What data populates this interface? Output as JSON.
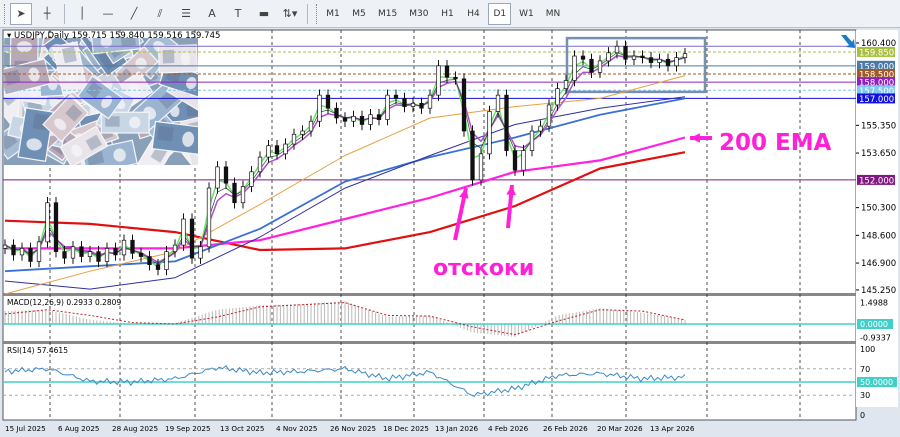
{
  "toolbar": {
    "tools": [
      {
        "name": "cursor-icon",
        "glyph": "➤"
      },
      {
        "name": "crosshair-icon",
        "glyph": "┼"
      },
      {
        "name": "vertical-line-icon",
        "glyph": "│"
      },
      {
        "name": "horizontal-line-icon",
        "glyph": "—"
      },
      {
        "name": "trendline-icon",
        "glyph": "╱"
      },
      {
        "name": "equidistant-channel-icon",
        "glyph": "⫽"
      },
      {
        "name": "fibonacci-icon",
        "glyph": "☰"
      },
      {
        "name": "text-icon",
        "glyph": "A"
      },
      {
        "name": "text-label-icon",
        "glyph": "T"
      },
      {
        "name": "rectangle-icon",
        "glyph": "▬"
      },
      {
        "name": "arrows-dropdown-icon",
        "glyph": "⇅▾"
      }
    ],
    "timeframes": [
      "M1",
      "M5",
      "M15",
      "M30",
      "H1",
      "H4",
      "D1",
      "W1",
      "MN"
    ],
    "active_timeframe": "D1"
  },
  "chart_data": {
    "type": "candlestick",
    "header": "USDJPY,Daily  159.715 159.840 159.516 159.745",
    "symbol": "USDJPY",
    "period": "Daily",
    "ohlc_last": {
      "open": 159.715,
      "high": 159.84,
      "low": 159.516,
      "close": 159.745
    },
    "ylim": [
      145.0,
      161.2
    ],
    "y_ticks": [
      "160.400",
      "155.350",
      "153.650",
      "150.300",
      "148.600",
      "146.900",
      "145.250"
    ],
    "x_ticks": [
      "15 Jul 2025",
      "6 Aug 2025",
      "28 Aug 2025",
      "19 Sep 2025",
      "13 Oct 2025",
      "4 Nov 2025",
      "26 Nov 2025",
      "18 Dec 2025",
      "13 Jan 2026",
      "4 Feb 2026",
      "26 Feb 2026",
      "20 Mar 2026",
      "13 Apr 2026"
    ],
    "date_range": [
      "15 Jul 2025",
      "22 Apr 2026"
    ],
    "closes": [
      148.0,
      147.4,
      147.8,
      147.0,
      148.2,
      150.6,
      147.6,
      147.2,
      147.9,
      147.3,
      147.6,
      147.0,
      147.8,
      147.4,
      148.3,
      147.5,
      147.3,
      146.8,
      146.5,
      147.6,
      148.0,
      149.6,
      147.2,
      147.9,
      151.5,
      152.8,
      151.8,
      150.6,
      151.6,
      152.5,
      153.4,
      154.1,
      153.6,
      154.2,
      154.8,
      155.0,
      155.6,
      157.2,
      156.4,
      155.8,
      155.6,
      155.9,
      155.4,
      156.0,
      155.7,
      157.2,
      157.0,
      156.5,
      156.7,
      156.4,
      157.2,
      159.0,
      158.3,
      158.2,
      155.0,
      152.0,
      153.6,
      156.2,
      157.2,
      153.8,
      152.6,
      153.8,
      155.0,
      155.3,
      156.6,
      157.6,
      158.1,
      159.6,
      159.4,
      158.6,
      159.3,
      159.8,
      160.2,
      159.4,
      159.6,
      159.5,
      159.2,
      159.4,
      159.0,
      159.5,
      159.745
    ],
    "moving_averages": [
      {
        "color": "#e01010",
        "values": [
          149.5,
          149.3,
          148.8,
          147.7,
          147.8,
          148.8,
          150.4,
          152.7,
          153.7
        ]
      },
      {
        "color": "#ff20e0",
        "values": [
          147.8,
          147.8,
          147.8,
          148.3,
          149.6,
          150.9,
          152.5,
          153.2,
          154.6
        ]
      },
      {
        "color": "#3a6fd8",
        "values": [
          146.4,
          146.7,
          147.0,
          149.0,
          151.9,
          153.4,
          154.6,
          156.0,
          157.0
        ]
      },
      {
        "color": "#3030a0",
        "values": [
          145.8,
          145.3,
          146.0,
          148.5,
          151.5,
          153.5,
          155.4,
          156.4,
          157.1
        ]
      },
      {
        "color": "#e8a040",
        "values": [
          145.0,
          146.4,
          147.6,
          150.5,
          153.5,
          155.8,
          156.5,
          157.0,
          158.4
        ]
      }
    ],
    "levels": [
      {
        "price": 160.2,
        "label": "",
        "color": "#7a6cc8",
        "style": "solid"
      },
      {
        "price": 159.85,
        "label": "159.850",
        "color": "#a8c040",
        "style": "dashed"
      },
      {
        "price": 159.0,
        "label": "159.000",
        "color": "#4a7aa8",
        "style": "solid"
      },
      {
        "price": 158.5,
        "label": "158.500",
        "color": "#a05a28",
        "style": "dashed"
      },
      {
        "price": 158.0,
        "label": "158.000",
        "color": "#9020c0",
        "style": "solid"
      },
      {
        "price": 157.5,
        "label": "157.500",
        "color": "#80c8f0",
        "style": "dashed"
      },
      {
        "price": 157.0,
        "label": "157.000",
        "color": "#1010e0",
        "style": "solid"
      },
      {
        "price": 152.0,
        "label": "152.000",
        "color": "#801880",
        "style": "solid"
      }
    ],
    "range_box": {
      "price_top": 160.7,
      "price_bottom": 157.4,
      "date_start": "23 Feb 2026",
      "color": "#7890b0"
    },
    "annotations": {
      "ema_label": "200 EMA",
      "bounces_label": "отскоки",
      "color": "#ff20d8"
    },
    "macd": {
      "header": "MACD(12,26,9) 0.2933 0.2809",
      "y_ticks": [
        "1.4988",
        "0.0000",
        "-0.9337"
      ],
      "ylim": [
        -0.9337,
        1.4988
      ],
      "histogram": [
        0.9,
        1.0,
        0.3,
        0.0,
        0.05,
        1.0,
        1.3,
        1.4,
        1.6,
        0.5,
        0.6,
        -0.6,
        -0.9,
        0.6,
        1.1,
        0.8,
        0.29
      ],
      "signal": [
        0.7,
        1.0,
        0.6,
        0.1,
        0.0,
        0.5,
        1.2,
        1.35,
        1.5,
        0.6,
        0.55,
        -0.2,
        -0.75,
        0.2,
        1.0,
        0.9,
        0.28
      ]
    },
    "rsi": {
      "header": "RSI(14) 57.4615",
      "y_ticks": [
        "100",
        "70",
        "50.0000",
        "30",
        "0"
      ],
      "ylim": [
        0,
        100
      ],
      "values": [
        66,
        70,
        51,
        50,
        55,
        72,
        64,
        66,
        70,
        55,
        65,
        30,
        40,
        60,
        63,
        55,
        57.5
      ]
    }
  }
}
